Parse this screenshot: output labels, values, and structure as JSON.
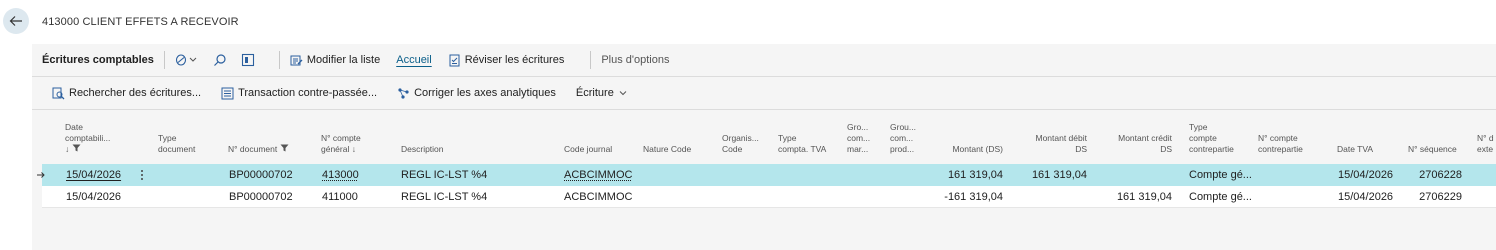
{
  "page": {
    "title": "413000 CLIENT EFFETS A RECEVOIR"
  },
  "actionbar": {
    "title": "Écritures comptables",
    "edit_list": "Modifier la liste",
    "home": "Accueil",
    "review": "Réviser les écritures",
    "more": "Plus d'options"
  },
  "subbar": {
    "find_entries": "Rechercher des écritures...",
    "reverse": "Transaction contre-passée...",
    "dimensions": "Corriger les axes analytiques",
    "entry": "Écriture"
  },
  "columns": [
    [
      "Date",
      "comptabili...",
      "↓"
    ],
    [
      "Type",
      "document"
    ],
    [
      "N° document"
    ],
    [
      "N° compte",
      "général ↓"
    ],
    [
      "Description"
    ],
    [
      "Code journal"
    ],
    [
      "Nature Code"
    ],
    [
      "Organis...",
      "Code"
    ],
    [
      "Type",
      "compta. TVA"
    ],
    [
      "Gro...",
      "com...",
      "mar..."
    ],
    [
      "Grou...",
      "com...",
      "prod..."
    ],
    [
      "Montant (DS)"
    ],
    [
      "Montant débit",
      "DS"
    ],
    [
      "Montant crédit",
      "DS"
    ],
    [
      "Type",
      "compte",
      "contrepartie"
    ],
    [
      "N° compte",
      "contrepartie"
    ],
    [
      "Date TVA"
    ],
    [
      "N° séquence"
    ],
    [
      "N° d",
      "exte"
    ]
  ],
  "rows": [
    {
      "date": "15/04/2026",
      "doc_no": "BP00000702",
      "account": "413000",
      "description": "REGL IC-LST %4",
      "journal": "ACBCIMMOC",
      "amount": "161 319,04",
      "debit": "161 319,04",
      "credit": "",
      "bal_type": "Compte gé...",
      "vat_date": "15/04/2026",
      "seq": "2706228"
    },
    {
      "date": "15/04/2026",
      "doc_no": "BP00000702",
      "account": "411000",
      "description": "REGL IC-LST %4",
      "journal": "ACBCIMMOC",
      "amount": "-161 319,04",
      "debit": "",
      "credit": "161 319,04",
      "bal_type": "Compte gé...",
      "vat_date": "15/04/2026",
      "seq": "2706229"
    }
  ]
}
